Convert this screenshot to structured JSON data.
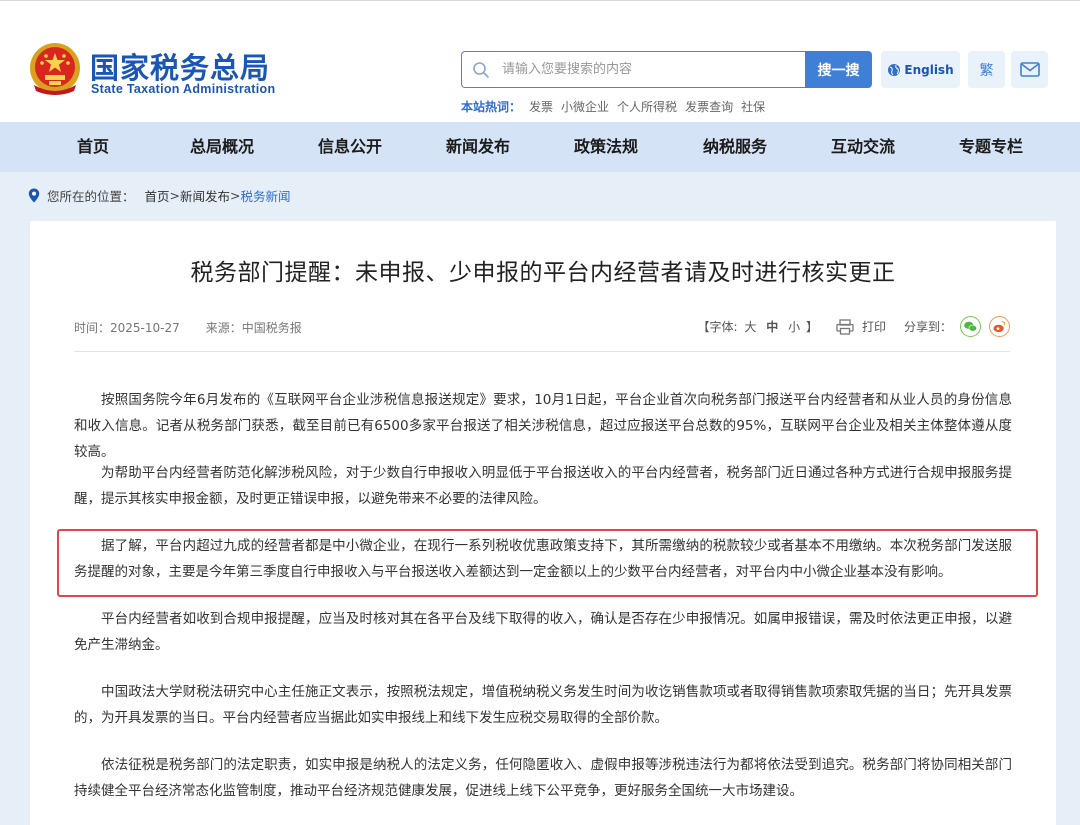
{
  "header": {
    "brand_cn": "国家税务总局",
    "brand_en": "State Taxation Administration",
    "search_placeholder": "请输入您要搜索的内容",
    "search_button": "搜一搜",
    "lang_button": "English",
    "trad_button": "繁",
    "hot_label": "本站热词：",
    "hot_words": [
      "发票",
      "小微企业",
      "个人所得税",
      "发票查询",
      "社保"
    ]
  },
  "nav": {
    "items": [
      "首页",
      "总局概况",
      "信息公开",
      "新闻发布",
      "政策法规",
      "纳税服务",
      "互动交流",
      "专题专栏"
    ]
  },
  "breadcrumb": {
    "prefix": "您所在的位置：",
    "home": "首页",
    "sep1": ">",
    "section": "新闻发布",
    "sep2": ">",
    "current": "税务新闻"
  },
  "article": {
    "title": "税务部门提醒：未申报、少申报的平台内经营者请及时进行核实更正",
    "time": "时间：2025-10-27",
    "source": "来源：中国税务报",
    "font_open": "【字体:",
    "font_large": "大",
    "font_medium": "中",
    "font_small": "小",
    "font_close": "】",
    "print": "打印",
    "share": "分享到：",
    "paragraphs": [
      "按照国务院今年6月发布的《互联网平台企业涉税信息报送规定》要求，10月1日起，平台企业首次向税务部门报送平台内经营者和从业人员的身份信息和收入信息。记者从税务部门获悉，截至目前已有6500多家平台报送了相关涉税信息，超过应报送平台总数的95%，互联网平台企业及相关主体整体遵从度较高。",
      "为帮助平台内经营者防范化解涉税风险，对于少数自行申报收入明显低于平台报送收入的平台内经营者，税务部门近日通过各种方式进行合规申报服务提醒，提示其核实申报金额，及时更正错误申报，以避免带来不必要的法律风险。",
      "据了解，平台内超过九成的经营者都是中小微企业，在现行一系列税收优惠政策支持下，其所需缴纳的税款较少或者基本不用缴纳。本次税务部门发送服务提醒的对象，主要是今年第三季度自行申报收入与平台报送收入差额达到一定金额以上的少数平台内经营者，对平台内中小微企业基本没有影响。",
      "平台内经营者如收到合规申报提醒，应当及时核对其在各平台及线下取得的收入，确认是否存在少申报情况。如属申报错误，需及时依法更正申报，以避免产生滞纳金。",
      "中国政法大学财税法研究中心主任施正文表示，按照税法规定，增值税纳税义务发生时间为收讫销售款项或者取得销售款项索取凭据的当日；先开具发票的，为开具发票的当日。平台内经营者应当据此如实申报线上和线下发生应税交易取得的全部价款。",
      "依法征税是税务部门的法定职责，如实申报是纳税人的法定义务，任何隐匿收入、虚假申报等涉税违法行为都将依法受到追究。税务部门将协同相关部门持续健全平台经济常态化监管制度，推动平台经济规范健康发展，促进线上线下公平竞争，更好服务全国统一大市场建设。"
    ]
  },
  "colors": {
    "brand_blue": "#1a56b4",
    "nav_bg": "#d4e3f5",
    "page_bg": "#e6eef8",
    "highlight_red": "#e0454b",
    "search_button_bg": "#3f7fd6"
  }
}
